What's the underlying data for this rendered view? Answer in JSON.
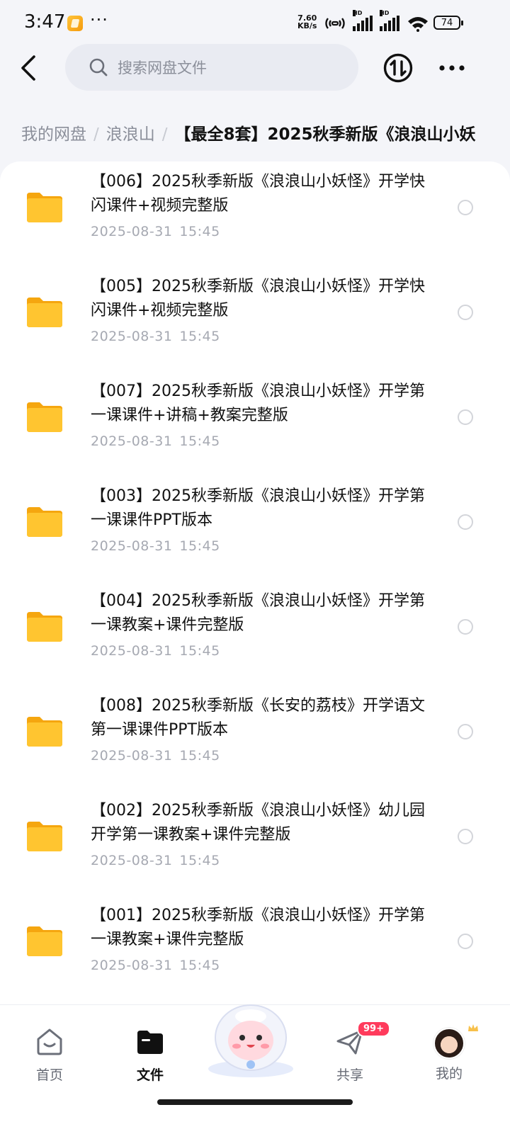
{
  "status_bar": {
    "time": "3:47",
    "dots": "···",
    "net_speed_value": "7.60",
    "net_speed_unit": "KB/s",
    "battery": "74",
    "hd_label": "HD"
  },
  "header": {
    "search_placeholder": "搜索网盘文件"
  },
  "breadcrumb": {
    "items": [
      "我的网盘",
      "浪浪山"
    ],
    "separator": "/",
    "current": "【最全8套】2025秋季新版《浪浪山小妖"
  },
  "files": [
    {
      "name": "【006】2025秋季新版《浪浪山小妖怪》开学快闪课件+视频完整版",
      "date": "2025-08-31",
      "time": "15:45"
    },
    {
      "name": "【005】2025秋季新版《浪浪山小妖怪》开学快闪课件+视频完整版",
      "date": "2025-08-31",
      "time": "15:45"
    },
    {
      "name": "【007】2025秋季新版《浪浪山小妖怪》开学第一课课件+讲稿+教案完整版",
      "date": "2025-08-31",
      "time": "15:45"
    },
    {
      "name": "【003】2025秋季新版《浪浪山小妖怪》开学第一课课件PPT版本",
      "date": "2025-08-31",
      "time": "15:45"
    },
    {
      "name": "【004】2025秋季新版《浪浪山小妖怪》开学第一课教案+课件完整版",
      "date": "2025-08-31",
      "time": "15:45"
    },
    {
      "name": "【008】2025秋季新版《长安的荔枝》开学语文第一课课件PPT版本",
      "date": "2025-08-31",
      "time": "15:45"
    },
    {
      "name": "【002】2025秋季新版《浪浪山小妖怪》幼儿园开学第一课教案+课件完整版",
      "date": "2025-08-31",
      "time": "15:45"
    },
    {
      "name": "【001】2025秋季新版《浪浪山小妖怪》开学第一课教案+课件完整版",
      "date": "2025-08-31",
      "time": "15:45"
    }
  ],
  "bottom_nav": {
    "home": "首页",
    "files": "文件",
    "share": "共享",
    "share_badge": "99+",
    "me": "我的"
  },
  "colors": {
    "folder": "#ffc530",
    "folder_dark": "#f5a60f",
    "badge": "#ff3b5c",
    "secondary_text": "#a6a9b2"
  }
}
